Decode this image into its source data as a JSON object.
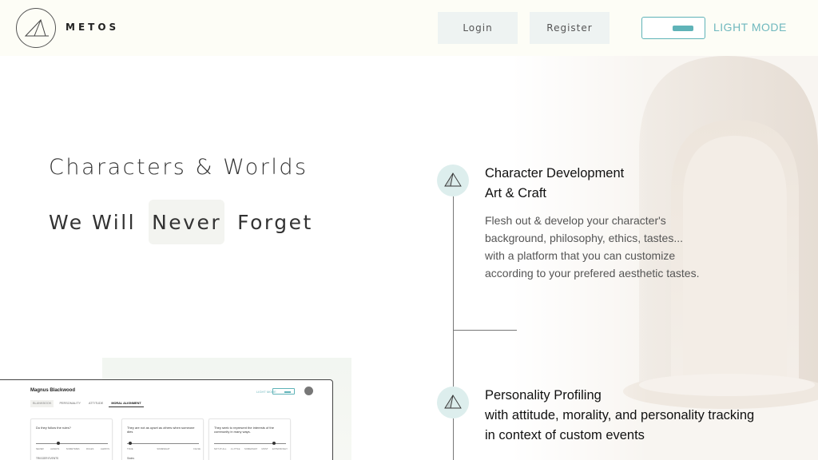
{
  "header": {
    "logo_text": "METOS",
    "login_label": "Login",
    "register_label": "Register",
    "mode_label": "LIGHT MODE",
    "accent_color": "#5fb3b8"
  },
  "hero": {
    "title": "Characters & Worlds",
    "tagline_words": [
      "We Will",
      "Never",
      "Forget"
    ]
  },
  "features": [
    {
      "icon": "pyramid-icon",
      "title_lines": [
        "Character Development",
        "Art & Craft"
      ],
      "description_lines": [
        "Flesh out & develop your character's",
        "background, philosophy, ethics, tastes...",
        "with a platform that you can customize",
        "according to your prefered aesthetic tastes."
      ]
    },
    {
      "icon": "pyramid-icon",
      "title_lines": [
        "Personality Profiling",
        "with attitude, morality, and personality tracking",
        "in context of custom events"
      ]
    }
  ],
  "preview": {
    "character_name": "Magnus Blackwood",
    "mode_label": "LIGHT MODE",
    "tabs": [
      "BLANKBOOK",
      "PERSONALITY",
      "ATTITUDE",
      "MORAL ALIGNMENT"
    ],
    "cards": [
      {
        "text": "Do they follow the rules?",
        "ticks": [
          "NEVER",
          "ALWAYS",
          "SOMETIMES",
          "RULES",
          "ALWAYS"
        ],
        "value": 0.3,
        "sub": "TRIGGER EVENTS"
      },
      {
        "text": "They are not as upset as others when someone dies",
        "ticks": [
          "TRUE",
          "",
          "SOMEWHAT",
          "",
          "FALSE"
        ],
        "value": 0.02,
        "sub": "States"
      },
      {
        "text": "They seek to represent the interests of the community in many ways.",
        "ticks": [
          "NOT AT ALL",
          "A LITTLE",
          "SOMEWHAT",
          "MOST",
          "EXTENSIVELY"
        ],
        "value": 0.85,
        "sub": ""
      }
    ]
  }
}
